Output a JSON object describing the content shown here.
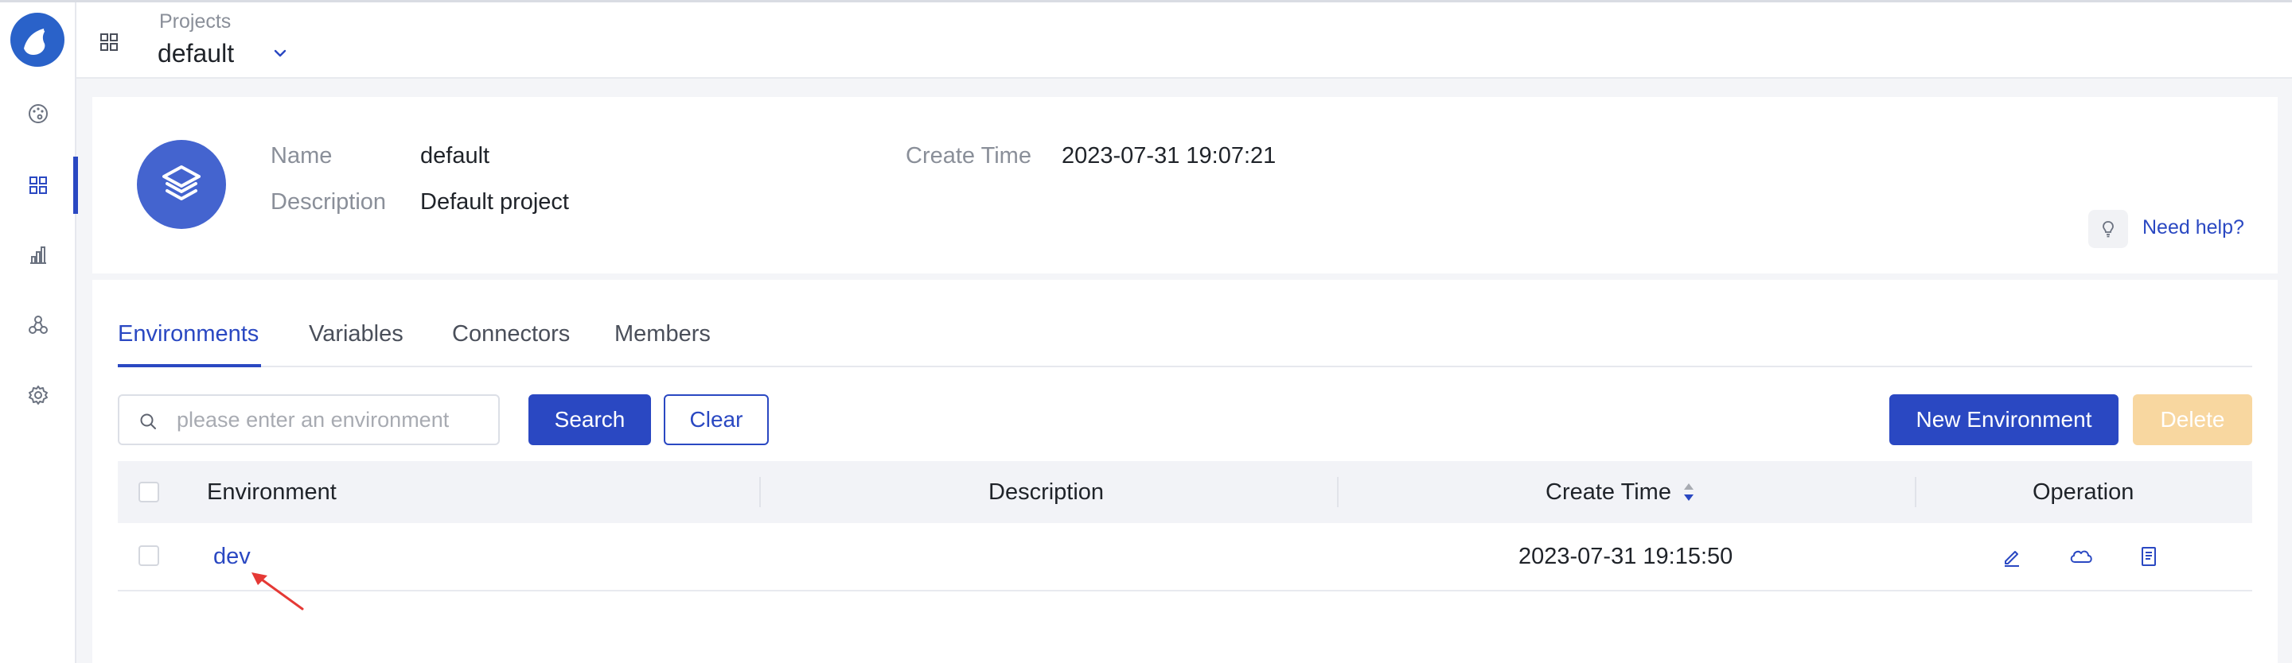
{
  "header": {
    "projects_label": "Projects",
    "project_name": "default"
  },
  "project": {
    "name_label": "Name",
    "name_value": "default",
    "description_label": "Description",
    "description_value": "Default project",
    "create_time_label": "Create Time",
    "create_time_value": "2023-07-31 19:07:21",
    "help_label": "Need help?"
  },
  "tabs": [
    {
      "label": "Environments",
      "active": true
    },
    {
      "label": "Variables",
      "active": false
    },
    {
      "label": "Connectors",
      "active": false
    },
    {
      "label": "Members",
      "active": false
    }
  ],
  "toolbar": {
    "search_placeholder": "please enter an environment",
    "search_value": "",
    "search_label": "Search",
    "clear_label": "Clear",
    "new_label": "New Environment",
    "delete_label": "Delete"
  },
  "table": {
    "columns": [
      "Environment",
      "Description",
      "Create Time",
      "Operation"
    ],
    "rows": [
      {
        "environment": "dev",
        "description": "",
        "create_time": "2023-07-31 19:15:50"
      }
    ]
  },
  "colors": {
    "accent": "#2a48c2",
    "avatar": "#4464cf",
    "delete_disabled": "#f8d7a0",
    "annotation_arrow": "#e53935"
  }
}
